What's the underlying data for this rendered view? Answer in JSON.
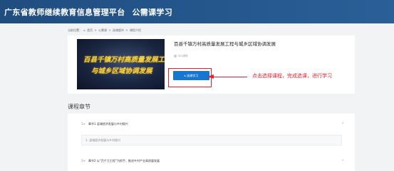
{
  "header": {
    "site_title": "广东省教师继续教育信息管理平台",
    "section_title": "公需课学习"
  },
  "breadcrumb": {
    "prefix": "当前位置：",
    "items": [
      "首页",
      "公需课",
      "选课超市",
      "课程介绍"
    ],
    "separator": ">"
  },
  "course": {
    "banner_line1": "百县千镇万村高质量发展工程",
    "banner_line2": "与城乡区域协调发展",
    "title": "百县千镇万村高质量发展工程与城乡区域协调发展",
    "meta": "321学时",
    "learn_button": "▸ 选课学习"
  },
  "annotation": {
    "text": "点击选择课程，完成选课，进行学习",
    "color": "#e5202b"
  },
  "chapters": {
    "heading": "课程章节",
    "items": [
      {
        "num": "1≡",
        "title": "章节1  县域经济发展与乡村振兴"
      },
      {
        "num": "2≡",
        "title": "章节2  以“百千万工程”为抓手，推进乡村产业高质量发展"
      }
    ],
    "section_1": "1. 县域经济发展与乡村振兴"
  },
  "colors": {
    "header_bg": "#25578d",
    "button_bg": "#1677d1",
    "banner_text": "#f3d34a"
  }
}
